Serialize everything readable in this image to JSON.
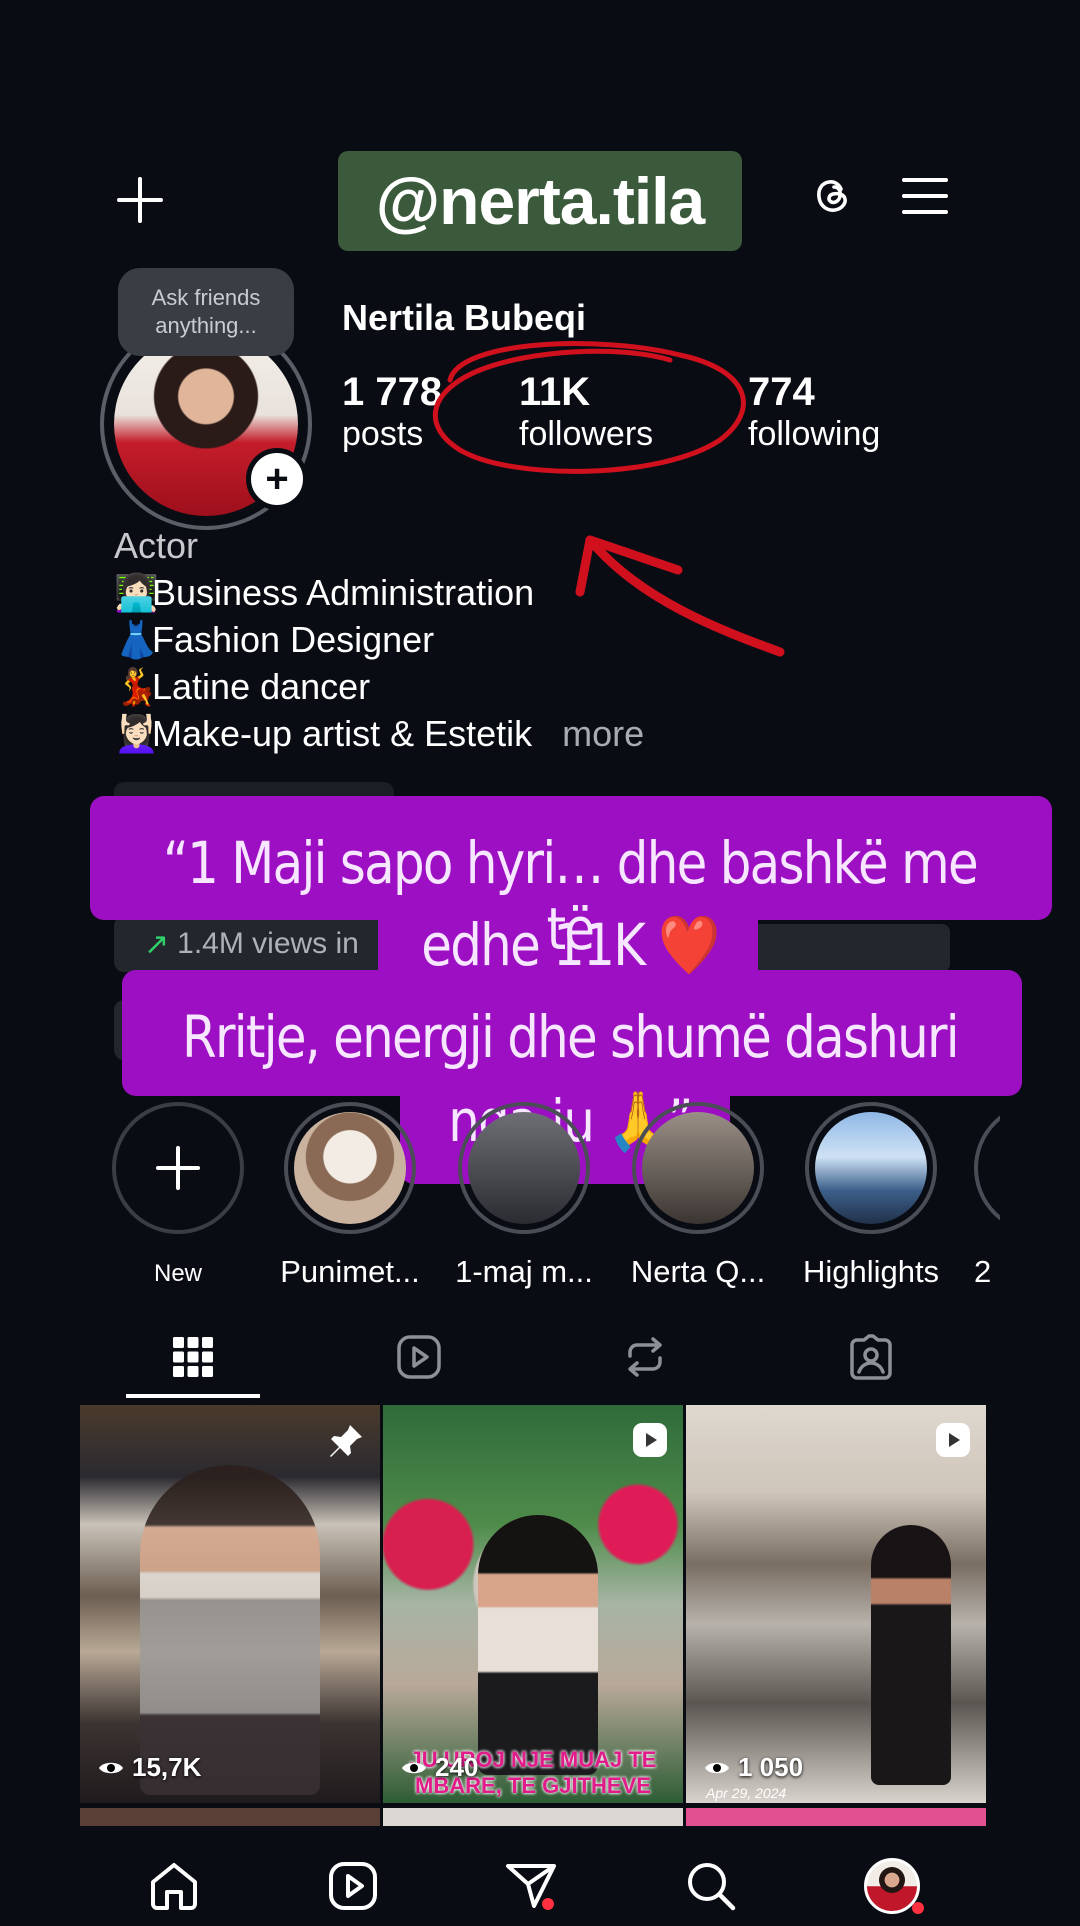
{
  "header": {
    "username": "@nerta.tila"
  },
  "profile": {
    "note": "Ask friends anything...",
    "display_name": "Nertila Bubeqi",
    "stats": [
      {
        "value": "1 778",
        "label": "posts"
      },
      {
        "value": "11K",
        "label": "followers"
      },
      {
        "value": "774",
        "label": "following"
      }
    ],
    "category": "Actor",
    "bio": [
      {
        "emoji": "👩🏻‍💻",
        "text": "Business Administration"
      },
      {
        "emoji": "👗",
        "text": "Fashion Designer"
      },
      {
        "emoji": "💃",
        "text": "Latine dancer"
      },
      {
        "emoji": "💆🏻‍♀️",
        "text": "Make-up artist & Estetik"
      }
    ],
    "more_label": "more",
    "views_text": "1.4M views in"
  },
  "caption": {
    "line1": "“1 Maji sapo hyri… dhe bashkë me të",
    "line2": "edhe 11K ❤️",
    "line3": "Rritje, energji dhe shumë dashuri",
    "line4": "nga ju 🙏”"
  },
  "highlights": [
    {
      "label": "New"
    },
    {
      "label": "Punimet..."
    },
    {
      "label": "1-maj m..."
    },
    {
      "label": "Nerta Q..."
    },
    {
      "label": "Highlights"
    },
    {
      "label": "2"
    }
  ],
  "tabs": [
    "grid-icon",
    "reels-icon",
    "reposts-icon",
    "tagged-icon"
  ],
  "grid": [
    {
      "views": "15,7K",
      "badge": "pin-icon",
      "overlay": ""
    },
    {
      "views": "240",
      "badge": "reel-icon",
      "overlay": "JU UROJ NJE MUAJ TE MBARE, TE GJITHEVE"
    },
    {
      "views": "1 050",
      "badge": "reel-icon",
      "overlay": "Apr 29, 2024"
    }
  ],
  "bottom_nav": [
    "home-icon",
    "reels-icon",
    "messages-icon",
    "search-icon",
    "profile-avatar"
  ],
  "colors": {
    "background": "#0a0c14",
    "username_pill": "#3a5a3b",
    "caption_band": "#9d0fc3",
    "annotation_red": "#d1101e",
    "notification_dot": "#ff3040"
  }
}
